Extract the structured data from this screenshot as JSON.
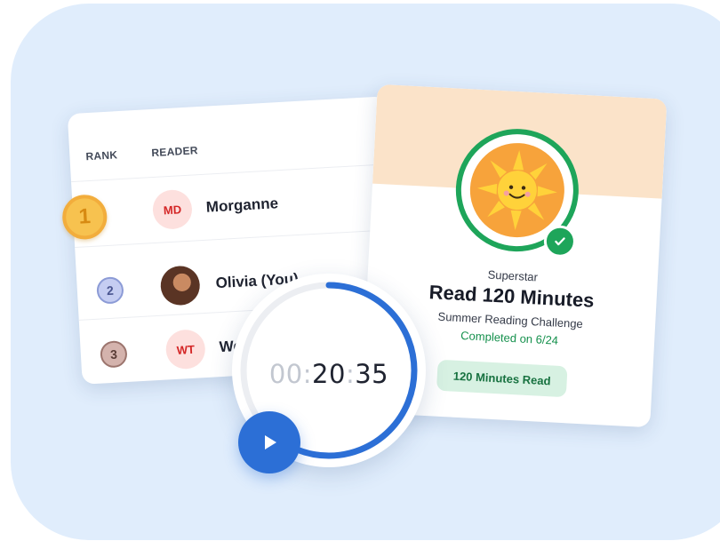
{
  "leaderboard": {
    "headers": {
      "rank": "RANK",
      "reader": "READER"
    },
    "rows": [
      {
        "rank": "1",
        "initials": "MD",
        "name": "Morganne",
        "avatar": "initials"
      },
      {
        "rank": "2",
        "initials": "",
        "name": "Olivia (You)",
        "avatar": "photo"
      },
      {
        "rank": "3",
        "initials": "WT",
        "name": "We",
        "avatar": "initials"
      }
    ]
  },
  "achievement": {
    "label": "Superstar",
    "title": "Read 120 Minutes",
    "subtitle": "Summer Reading Challenge",
    "completed": "Completed on 6/24",
    "pill": "120 Minutes Read",
    "badge_icon": "sun-badge-icon",
    "check_icon": "check-icon"
  },
  "timer": {
    "hours": "00",
    "sep1": ":",
    "minutes": "20",
    "sep2": ":",
    "seconds": "35",
    "progress_fraction": 0.62,
    "play_icon": "play-icon"
  },
  "colors": {
    "background": "#e0edfc",
    "accent_blue": "#2c6fd6",
    "success_green": "#1ea55a",
    "badge_orange": "#f7a33b",
    "initials_red": "#d42626"
  }
}
